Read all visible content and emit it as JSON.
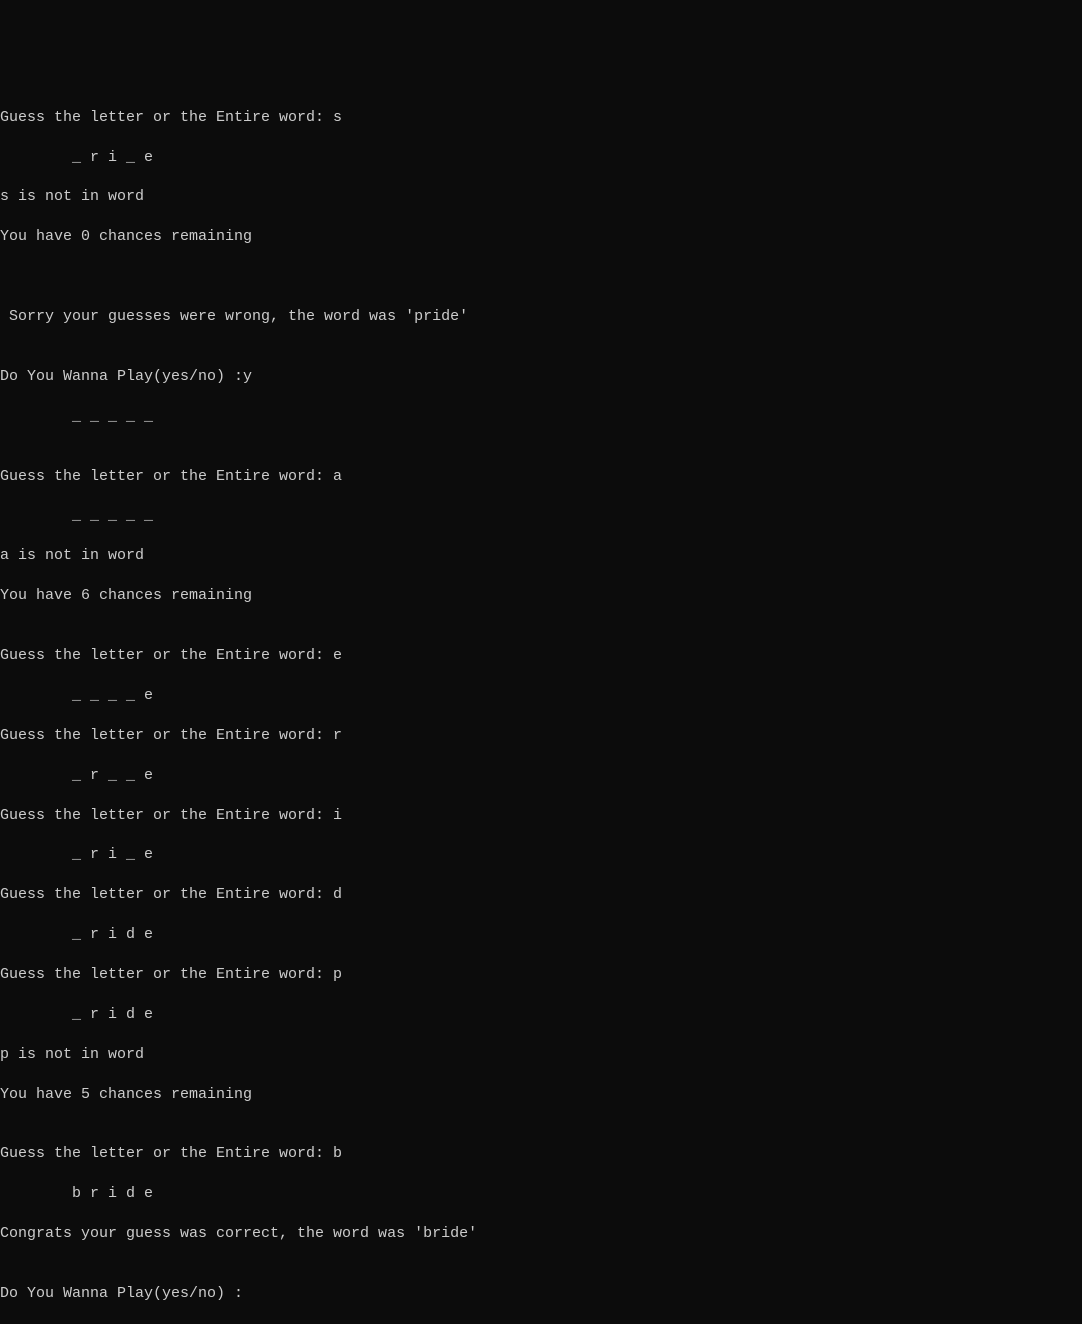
{
  "lines": [
    "Guess the letter or the Entire word: s",
    "        _ r i _ e",
    "s is not in word",
    "You have 0 chances remaining",
    "",
    "",
    " Sorry your guesses were wrong, the word was 'pride'",
    "",
    "Do You Wanna Play(yes/no) :y",
    "        _ _ _ _ _",
    "",
    "Guess the letter or the Entire word: a",
    "        _ _ _ _ _",
    "a is not in word",
    "You have 6 chances remaining",
    "",
    "Guess the letter or the Entire word: e",
    "        _ _ _ _ e",
    "Guess the letter or the Entire word: r",
    "        _ r _ _ e",
    "Guess the letter or the Entire word: i",
    "        _ r i _ e",
    "Guess the letter or the Entire word: d",
    "        _ r i d e",
    "Guess the letter or the Entire word: p",
    "        _ r i d e",
    "p is not in word",
    "You have 5 chances remaining",
    "",
    "Guess the letter or the Entire word: b",
    "        b r i d e",
    "Congrats your guess was correct, the word was 'bride'",
    "",
    "Do You Wanna Play(yes/no) :"
  ]
}
